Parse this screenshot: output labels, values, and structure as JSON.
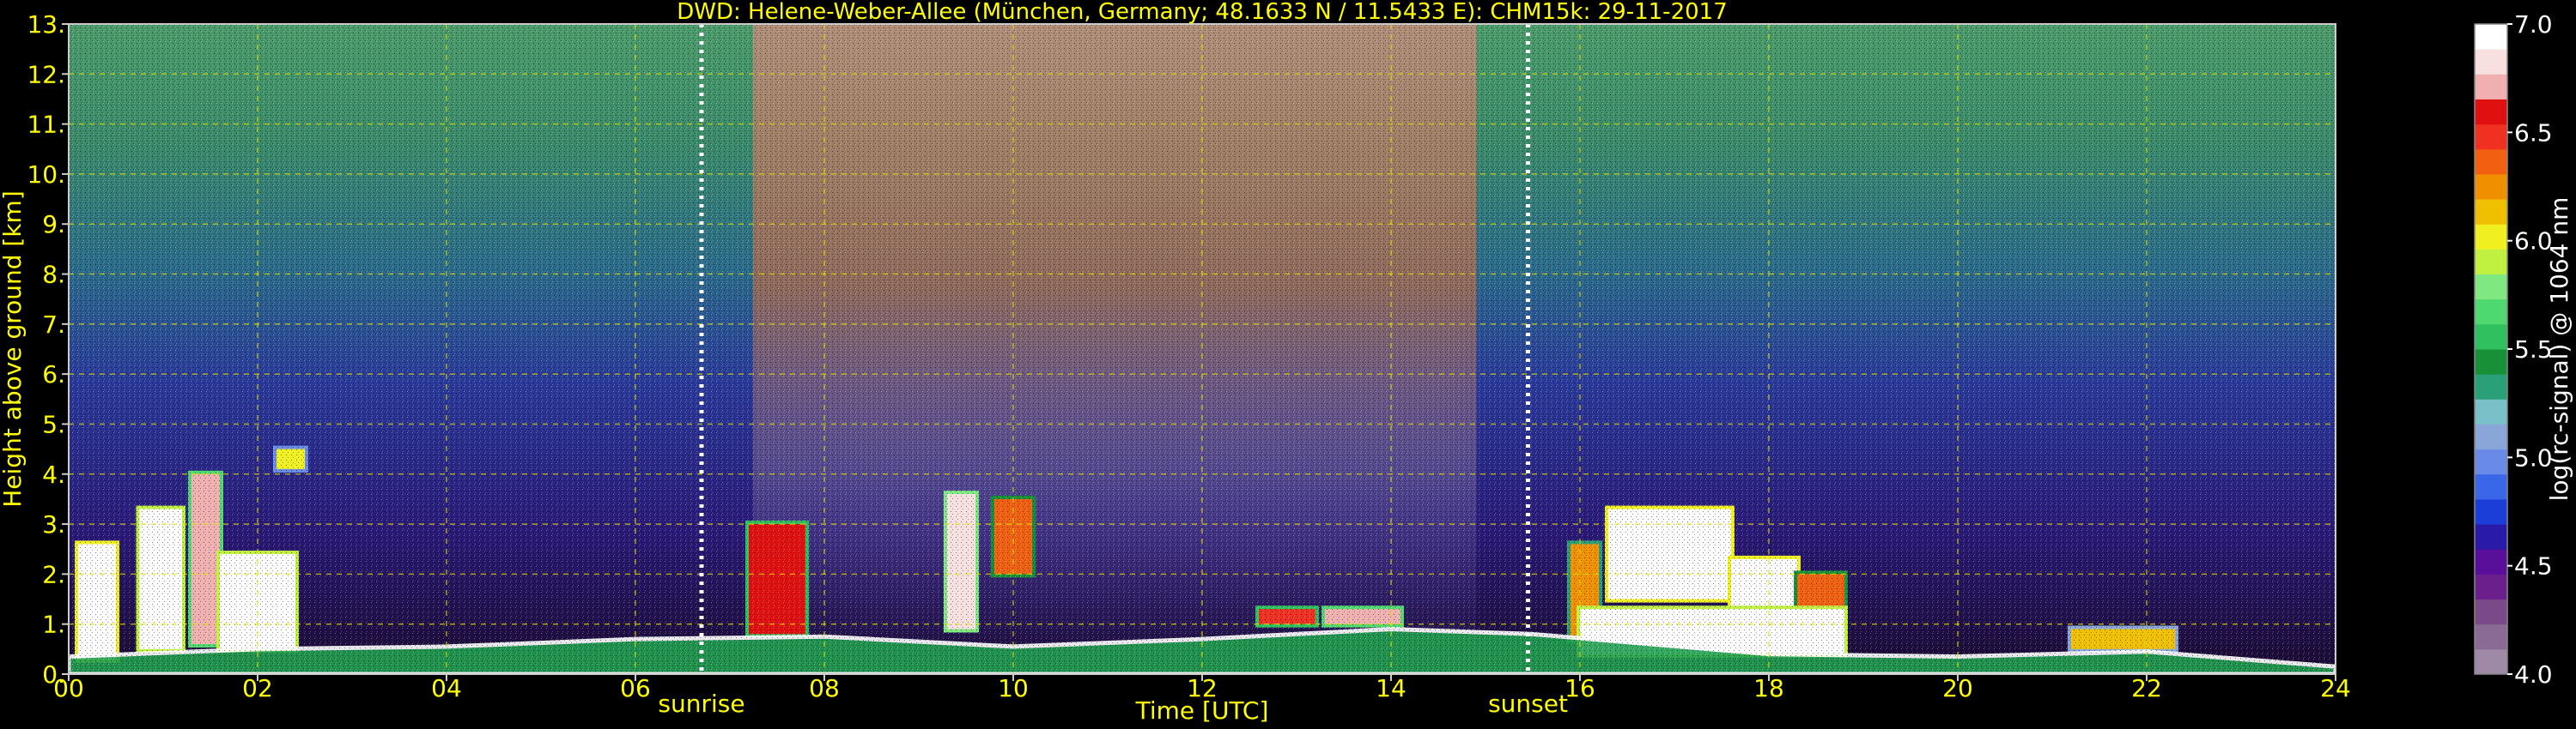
{
  "chart_data": {
    "type": "heatmap",
    "title": "DWD: Helene-Weber-Allee (München, Germany; 48.1633 N / 11.5433 E):    CHM15k: 29-11-2017",
    "xlabel": "Time [UTC]",
    "ylabel": "Height above ground [km]",
    "xlim": [
      0,
      24
    ],
    "ylim": [
      0,
      13
    ],
    "x_ticks": [
      0,
      2,
      4,
      6,
      8,
      10,
      12,
      14,
      16,
      18,
      20,
      22,
      24
    ],
    "x_tick_labels": [
      "00",
      "02",
      "04",
      "06",
      "08",
      "10",
      "12",
      "14",
      "16",
      "18",
      "20",
      "22",
      "24"
    ],
    "y_ticks": [
      0,
      1,
      2,
      3,
      4,
      5,
      6,
      7,
      8,
      9,
      10,
      11,
      12,
      13
    ],
    "y_tick_labels": [
      "0.",
      "1.",
      "2.",
      "3.",
      "4.",
      "5.",
      "6.",
      "7.",
      "8.",
      "9.",
      "10.",
      "11.",
      "12.",
      "13."
    ],
    "grid": true,
    "events": [
      {
        "label": "sunrise",
        "time": 6.7
      },
      {
        "label": "sunset",
        "time": 15.45
      }
    ],
    "colorbar": {
      "label": "log(rc-signal) @ 1064 nm",
      "range": [
        4.0,
        7.0
      ],
      "ticks": [
        4.0,
        4.5,
        5.0,
        5.5,
        6.0,
        6.5,
        7.0
      ],
      "tick_labels": [
        "4.0",
        "4.5",
        "5.0",
        "5.5",
        "6.0",
        "6.5",
        "7.0"
      ],
      "colors": [
        "#9e8aa6",
        "#8a6b95",
        "#7a4a88",
        "#6a1f8a",
        "#5a0f9a",
        "#2a1aa8",
        "#1c3ed8",
        "#3a66e8",
        "#6a8ae8",
        "#8aa6d8",
        "#7ac0c8",
        "#2aa078",
        "#189038",
        "#30c060",
        "#50d870",
        "#80e880",
        "#c0f040",
        "#f0f020",
        "#f0c000",
        "#f09000",
        "#f06010",
        "#f03020",
        "#e01010",
        "#f0b0b0",
        "#f8e0e0",
        "#ffffff"
      ]
    },
    "cloud_layers": [
      {
        "t0": 0.1,
        "t1": 0.5,
        "h0": 0.3,
        "h1": 2.6,
        "v": 7.0
      },
      {
        "t0": 0.75,
        "t1": 1.2,
        "h0": 0.5,
        "h1": 3.3,
        "v": 6.9
      },
      {
        "t0": 1.3,
        "t1": 1.6,
        "h0": 0.6,
        "h1": 4.0,
        "v": 6.7
      },
      {
        "t0": 1.6,
        "t1": 2.4,
        "h0": 0.5,
        "h1": 2.4,
        "v": 6.9
      },
      {
        "t0": 2.2,
        "t1": 2.5,
        "h0": 4.1,
        "h1": 4.5,
        "v": 6.0
      },
      {
        "t0": 7.2,
        "t1": 7.8,
        "h0": 0.8,
        "h1": 3.0,
        "v": 6.6
      },
      {
        "t0": 9.3,
        "t1": 9.6,
        "h0": 0.9,
        "h1": 3.6,
        "v": 6.8
      },
      {
        "t0": 9.8,
        "t1": 10.2,
        "h0": 2.0,
        "h1": 3.5,
        "v": 6.4
      },
      {
        "t0": 12.6,
        "t1": 13.2,
        "h0": 1.0,
        "h1": 1.3,
        "v": 6.5
      },
      {
        "t0": 13.3,
        "t1": 14.1,
        "h0": 1.0,
        "h1": 1.3,
        "v": 6.7
      },
      {
        "t0": 15.9,
        "t1": 16.2,
        "h0": 0.7,
        "h1": 2.6,
        "v": 6.3
      },
      {
        "t0": 16.3,
        "t1": 17.6,
        "h0": 1.5,
        "h1": 3.3,
        "v": 7.0
      },
      {
        "t0": 17.6,
        "t1": 18.3,
        "h0": 0.8,
        "h1": 2.3,
        "v": 7.0
      },
      {
        "t0": 18.3,
        "t1": 18.8,
        "h0": 0.8,
        "h1": 2.0,
        "v": 6.4
      },
      {
        "t0": 16.0,
        "t1": 18.8,
        "h0": 0.4,
        "h1": 1.3,
        "v": 6.9
      },
      {
        "t0": 21.2,
        "t1": 22.3,
        "h0": 0.5,
        "h1": 0.9,
        "v": 6.1
      }
    ],
    "boundary_layer": [
      {
        "t": 0.0,
        "h": 0.35
      },
      {
        "t": 2.0,
        "h": 0.5
      },
      {
        "t": 4.0,
        "h": 0.55
      },
      {
        "t": 6.0,
        "h": 0.7
      },
      {
        "t": 8.0,
        "h": 0.75
      },
      {
        "t": 10.0,
        "h": 0.55
      },
      {
        "t": 12.0,
        "h": 0.7
      },
      {
        "t": 14.0,
        "h": 0.9
      },
      {
        "t": 15.5,
        "h": 0.8
      },
      {
        "t": 18.0,
        "h": 0.4
      },
      {
        "t": 20.0,
        "h": 0.35
      },
      {
        "t": 22.0,
        "h": 0.45
      },
      {
        "t": 24.0,
        "h": 0.15
      }
    ]
  }
}
